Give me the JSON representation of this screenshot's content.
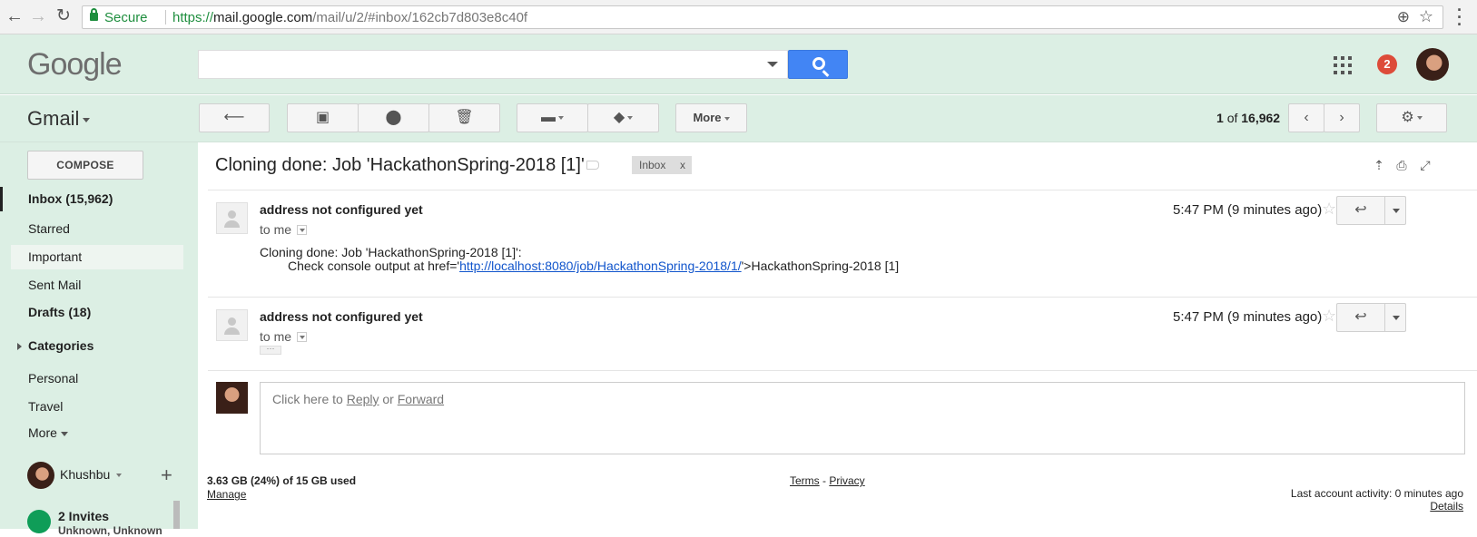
{
  "browser": {
    "secure_label": "Secure",
    "url_scheme": "https://",
    "url_host": "mail.google.com",
    "url_path": "/mail/u/2/#inbox/162cb7d803e8c40f"
  },
  "header": {
    "logo": "Google",
    "notification_count": "2"
  },
  "toolbar": {
    "app_label": "Gmail",
    "more_label": "More",
    "pager_current": "1",
    "pager_of": "of",
    "pager_total": "16,962"
  },
  "sidebar": {
    "compose_label": "COMPOSE",
    "items": [
      {
        "label": "Inbox (15,962)"
      },
      {
        "label": "Starred"
      },
      {
        "label": "Important"
      },
      {
        "label": "Sent Mail"
      },
      {
        "label": "Drafts (18)"
      },
      {
        "label": "Categories"
      },
      {
        "label": "Personal"
      },
      {
        "label": "Travel"
      },
      {
        "label": "More"
      }
    ],
    "hangout_user": "Khushbu",
    "invites_label": "2 Invites",
    "invites_sub": "Unknown, Unknown"
  },
  "thread": {
    "subject": "Cloning done: Job 'HackathonSpring-2018 [1]'",
    "label_chip": "Inbox",
    "label_chip_close": "x",
    "messages": [
      {
        "sender": "address not configured yet",
        "to": "to me",
        "time": "5:47 PM (9 minutes ago)",
        "body_line1": "Cloning done: Job 'HackathonSpring-2018 [1]':",
        "body_line2_prefix": "Check console output at href='",
        "body_link": "http://localhost:8080/job/HackathonSpring-2018/1/",
        "body_line2_suffix": "'>HackathonSpring-2018 [1]"
      },
      {
        "sender": "address not configured yet",
        "to": "to me",
        "time": "5:47 PM (9 minutes ago)"
      }
    ],
    "reply_prompt_prefix": "Click here to ",
    "reply_link": "Reply",
    "reply_or": " or ",
    "forward_link": "Forward"
  },
  "footer": {
    "storage": "3.63 GB (24%) of 15 GB used",
    "manage": "Manage",
    "terms": "Terms",
    "separator": " - ",
    "privacy": "Privacy",
    "activity": "Last account activity: 0 minutes ago",
    "details": "Details"
  },
  "colors": {
    "gmail_bg": "#dcefe4",
    "search_blue": "#4285f4",
    "badge_red": "#dd4b39",
    "link_blue": "#1155cc"
  }
}
